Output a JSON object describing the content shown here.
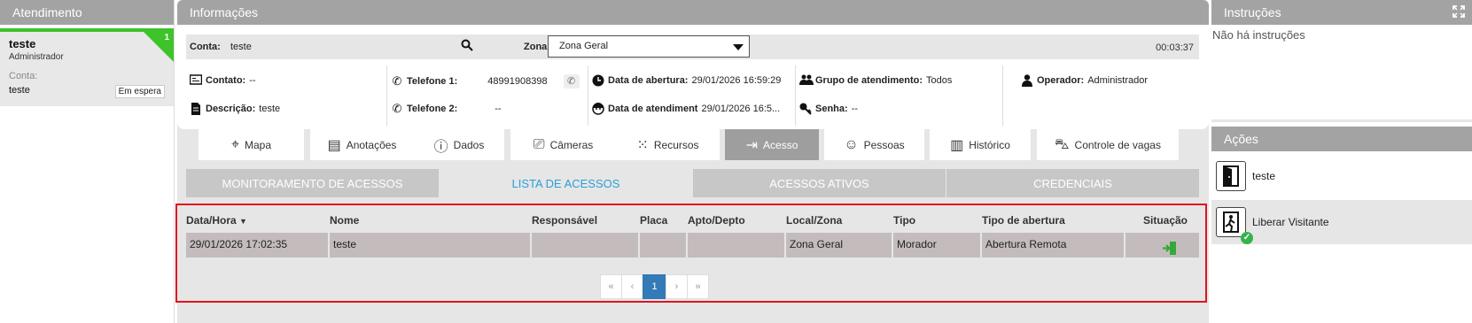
{
  "colors": {
    "header_gray": "#a3a3a3",
    "active_green": "#3ec32a",
    "link_blue": "#2a9fd8",
    "alert_red": "#e0141e",
    "pager_blue": "#337ab7"
  },
  "atendimento": {
    "title": "Atendimento",
    "card": {
      "name": "teste",
      "role": "Administrador",
      "conta_label": "Conta:",
      "conta_value": "teste",
      "badge": "1",
      "status": "Em espera"
    }
  },
  "info": {
    "title": "Informações",
    "conta_label": "Conta:",
    "conta_value": "teste",
    "zona_label": "Zona:",
    "zona_value": "Zona Geral",
    "timer": "00:03:37",
    "contato_label": "Contato:",
    "contato_value": "--",
    "descricao_label": "Descrição:",
    "descricao_value": "teste",
    "telefone1_label": "Telefone 1:",
    "telefone1_value": "48991908398",
    "telefone2_label": "Telefone 2:",
    "telefone2_value": "--",
    "data_abertura_label": "Data de abertura:",
    "data_abertura_value": "29/01/2026 16:59:29",
    "data_atendimento_label": "Data de atendiment",
    "data_atendimento_value": "29/01/2026 16:5...",
    "grupo_label": "Grupo de atendimento:",
    "grupo_value": "Todos",
    "senha_label": "Senha:",
    "senha_value": "--",
    "operador_label": "Operador:",
    "operador_value": "Administrador"
  },
  "tabs": [
    {
      "label": "Mapa",
      "icon": "map-pin-icon"
    },
    {
      "label": "Anotações",
      "icon": "notes-icon"
    },
    {
      "label": "Dados",
      "icon": "info-icon"
    },
    {
      "label": "Câmeras",
      "icon": "camera-icon"
    },
    {
      "label": "Recursos",
      "icon": "grid-dots-icon"
    },
    {
      "label": "Acesso",
      "icon": "access-arrow-icon"
    },
    {
      "label": "Pessoas",
      "icon": "person-icon"
    },
    {
      "label": "Histórico",
      "icon": "document-icon"
    },
    {
      "label": "Controle de vagas",
      "icon": "car-icon"
    }
  ],
  "subtabs": [
    "MONITORAMENTO DE ACESSOS",
    "LISTA DE ACESSOS",
    "ACESSOS ATIVOS",
    "CREDENCIAIS"
  ],
  "table": {
    "headers": [
      "Data/Hora",
      "Nome",
      "Responsável",
      "Placa",
      "Apto/Depto",
      "Local/Zona",
      "Tipo",
      "Tipo de abertura",
      "Situação"
    ],
    "rows": [
      [
        "29/01/2026 17:02:35",
        "teste",
        "",
        "",
        "",
        "Zona Geral",
        "Morador",
        "Abertura Remota",
        ""
      ]
    ],
    "pager": {
      "first": "«",
      "prev": "‹",
      "current": "1",
      "next": "›",
      "last": "»"
    }
  },
  "instrucoes": {
    "title": "Instruções",
    "text": "Não há instruções"
  },
  "acoes": {
    "title": "Ações",
    "items": [
      {
        "label": "teste",
        "icon": "door-icon"
      },
      {
        "label": "Liberar Visitante",
        "icon": "door-exit-check-icon"
      }
    ]
  }
}
